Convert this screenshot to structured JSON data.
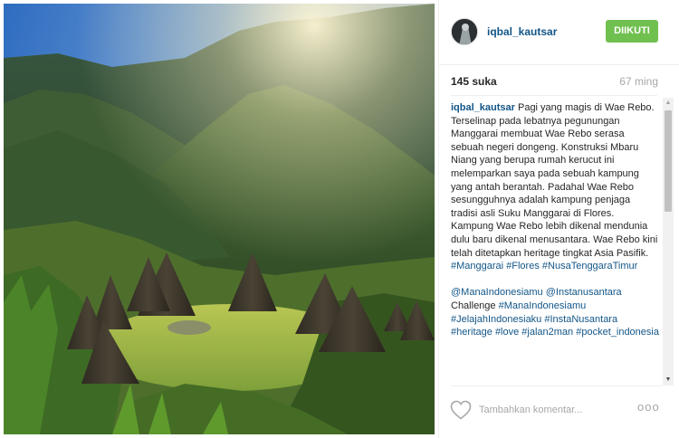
{
  "post": {
    "username": "iqbal_kautsar",
    "follow_label": "DIIKUTI",
    "likes": "145 suka",
    "time": "67 ming",
    "comment_placeholder": "Tambahkan komentar...",
    "more_label": "ooo"
  },
  "caption": {
    "username": "iqbal_kautsar",
    "text": "Pagi yang magis di Wae Rebo. Terselinap pada lebatnya pegunungan Manggarai membuat Wae Rebo serasa sebuah negeri dongeng. Konstruksi Mbaru Niang yang berupa rumah kerucut ini melemparkan saya pada sebuah kampung yang antah berantah. Padahal Wae Rebo sesungguhnya adalah kampung penjaga tradisi asli Suku Manggarai di Flores. Kampung Wae Rebo lebih dikenal mendunia dulu baru dikenal menusantara. Wae Rebo kini telah ditetapkan heritage tingkat Asia Pasifik.",
    "tags": [
      "#Manggarai",
      "#Flores",
      "#NusaTenggaraTimur"
    ]
  },
  "comment2": {
    "mention1": "@ManaIndonesiamu",
    "mention2": "@Instanusantara",
    "word": "Challenge",
    "tags": [
      "#ManaIndonesiamu",
      "#JelajahIndonesiaku",
      "#InstaNusantara",
      "#heritage",
      "#love",
      "#jalan2man",
      "#pocket_indonesia"
    ]
  },
  "scrollbar": {
    "up_arrow": "▲",
    "down_arrow": "▼"
  },
  "icons": {
    "avatar": "user-avatar",
    "like": "heart-outline-icon",
    "options": "ellipsis-icon"
  },
  "colors": {
    "link": "#125688",
    "follow_button": "#70c050",
    "muted": "#a5a7aa"
  }
}
